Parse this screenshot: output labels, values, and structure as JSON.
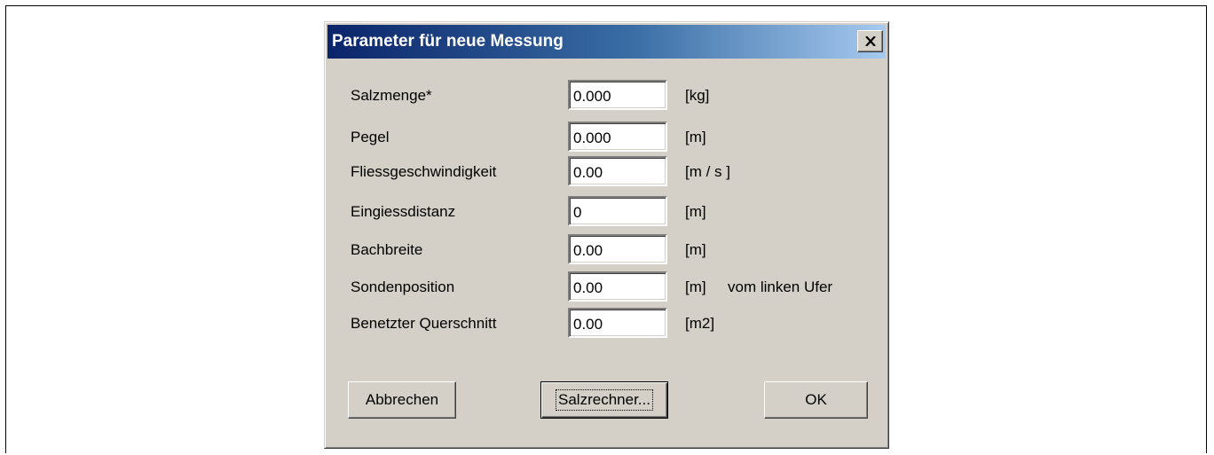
{
  "dialog": {
    "title": "Parameter für neue Messung",
    "close_symbol": "×"
  },
  "fields": [
    {
      "label": "Salzmenge*",
      "value": "0.000",
      "unit": "[kg]",
      "note": ""
    },
    {
      "label": "Pegel",
      "value": "0.000",
      "unit": "[m]",
      "note": ""
    },
    {
      "label": "Fliessgeschwindigkeit",
      "value": "0.00",
      "unit": "[m / s ]",
      "note": ""
    },
    {
      "label": "Eingiessdistanz",
      "value": "0",
      "unit": "[m]",
      "note": ""
    },
    {
      "label": "Bachbreite",
      "value": "0.00",
      "unit": "[m]",
      "note": ""
    },
    {
      "label": "Sondenposition",
      "value": "0.00",
      "unit": "[m]",
      "note": "vom linken Ufer"
    },
    {
      "label": "Benetzter Querschnitt",
      "value": "0.00",
      "unit": "[m2]",
      "note": ""
    }
  ],
  "buttons": {
    "cancel": "Abbrechen",
    "salt_calculator": "Salzrechner...",
    "ok": "OK"
  },
  "colors": {
    "title_gradient_start": "#0a246a",
    "title_gradient_end": "#a6caf0",
    "dialog_face": "#d4d0c8"
  }
}
